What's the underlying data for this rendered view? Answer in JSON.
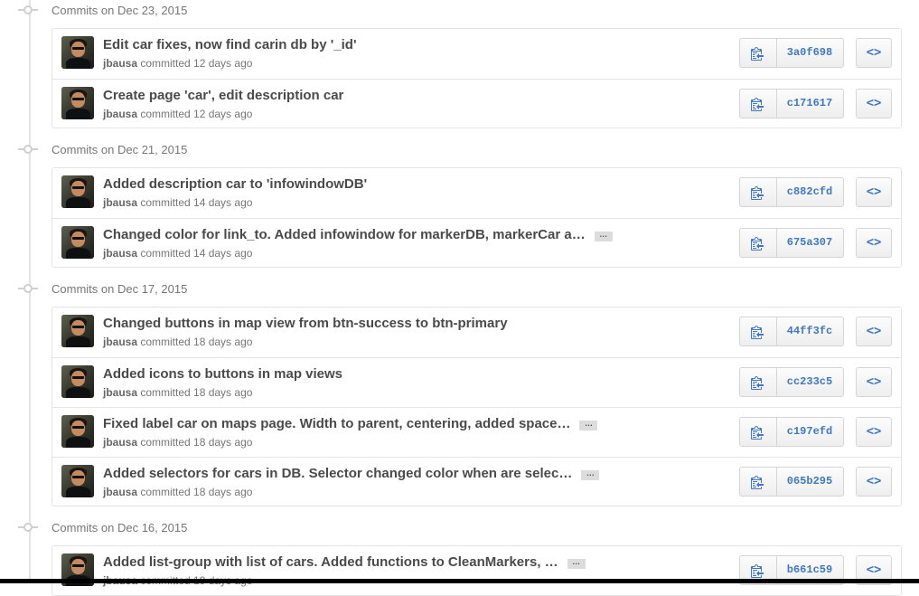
{
  "icons": {
    "copy": "clippy-icon",
    "browse": "code-icon",
    "timeline_node": "commit-node-icon"
  },
  "colors": {
    "sha_link": "#4078c0",
    "muted_text": "#767676",
    "border": "#e5e5e5"
  },
  "ellipsis_label": "…",
  "browse_label": "<>",
  "groups": [
    {
      "title": "Commits on Dec 23, 2015",
      "commits": [
        {
          "message": "Edit car fixes, now find carin db by '_id'",
          "author": "jbausa",
          "meta": " committed 12 days ago",
          "sha": "3a0f698",
          "ellipsis": false
        },
        {
          "message": "Create page 'car', edit description car",
          "author": "jbausa",
          "meta": " committed 12 days ago",
          "sha": "c171617",
          "ellipsis": false
        }
      ]
    },
    {
      "title": "Commits on Dec 21, 2015",
      "commits": [
        {
          "message": "Added description car to 'infowindowDB'",
          "author": "jbausa",
          "meta": " committed 14 days ago",
          "sha": "c882cfd",
          "ellipsis": false
        },
        {
          "message": "Changed color for link_to. Added infowindow for markerDB, markerCar a…",
          "author": "jbausa",
          "meta": " committed 14 days ago",
          "sha": "675a307",
          "ellipsis": true
        }
      ]
    },
    {
      "title": "Commits on Dec 17, 2015",
      "commits": [
        {
          "message": "Changed buttons in map view from btn-success to btn-primary",
          "author": "jbausa",
          "meta": " committed 18 days ago",
          "sha": "44ff3fc",
          "ellipsis": false
        },
        {
          "message": "Added icons to buttons in map views",
          "author": "jbausa",
          "meta": " committed 18 days ago",
          "sha": "cc233c5",
          "ellipsis": false
        },
        {
          "message": "Fixed label car on maps page. Width to parent, centering, added space…",
          "author": "jbausa",
          "meta": " committed 18 days ago",
          "sha": "c197efd",
          "ellipsis": true
        },
        {
          "message": "Added selectors for cars in DB. Selector changed color when are selec…",
          "author": "jbausa",
          "meta": " committed 18 days ago",
          "sha": "065b295",
          "ellipsis": true
        }
      ]
    },
    {
      "title": "Commits on Dec 16, 2015",
      "commits": [
        {
          "message": "Added list-group with list of cars. Added functions to CleanMarkers, …",
          "author": "jbausa",
          "meta": " committed 19 days ago",
          "sha": "b661c59",
          "ellipsis": true
        }
      ]
    }
  ]
}
